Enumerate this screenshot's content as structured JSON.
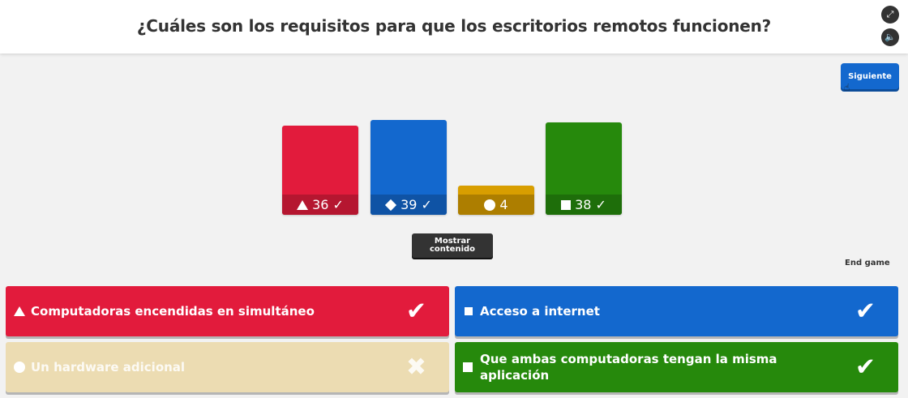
{
  "header": {
    "question": "¿Cuáles son los requisitos para que los escritorios remotos funcionen?",
    "fullscreen_icon": "expand-icon",
    "sound_icon": "speaker-icon"
  },
  "controls": {
    "next_label": "Siguiente",
    "show_content_line1": "Mostrar",
    "show_content_line2": "contenido",
    "end_game_label": "End game"
  },
  "results": [
    {
      "shape": "triangle",
      "count": "36",
      "mark": "✓",
      "color": "#e21b3c",
      "label_color": "#b51630"
    },
    {
      "shape": "diamond",
      "count": "39",
      "mark": "✓",
      "color": "#1368ce",
      "label_color": "#0f53a5"
    },
    {
      "shape": "circle",
      "count": "4",
      "mark": "",
      "color": "#d89e00",
      "label_color": "#ad7e00"
    },
    {
      "shape": "square",
      "count": "38",
      "mark": "✓",
      "color": "#26890c",
      "label_color": "#1e6e0a"
    }
  ],
  "answers": [
    {
      "shape": "triangle",
      "text": "Computadoras encendidas en simultáneo",
      "correct": true,
      "mark": "✔",
      "color": "#e21b3c"
    },
    {
      "shape": "diamond",
      "text": "Acceso a internet",
      "correct": true,
      "mark": "✔",
      "color": "#1368ce"
    },
    {
      "shape": "circle",
      "text": "Un hardware adicional",
      "correct": false,
      "mark": "✖",
      "color": "#ecdcb2"
    },
    {
      "shape": "square",
      "text": "Que ambas computadoras tengan la misma aplicación",
      "correct": true,
      "mark": "✔",
      "color": "#26890c"
    }
  ]
}
